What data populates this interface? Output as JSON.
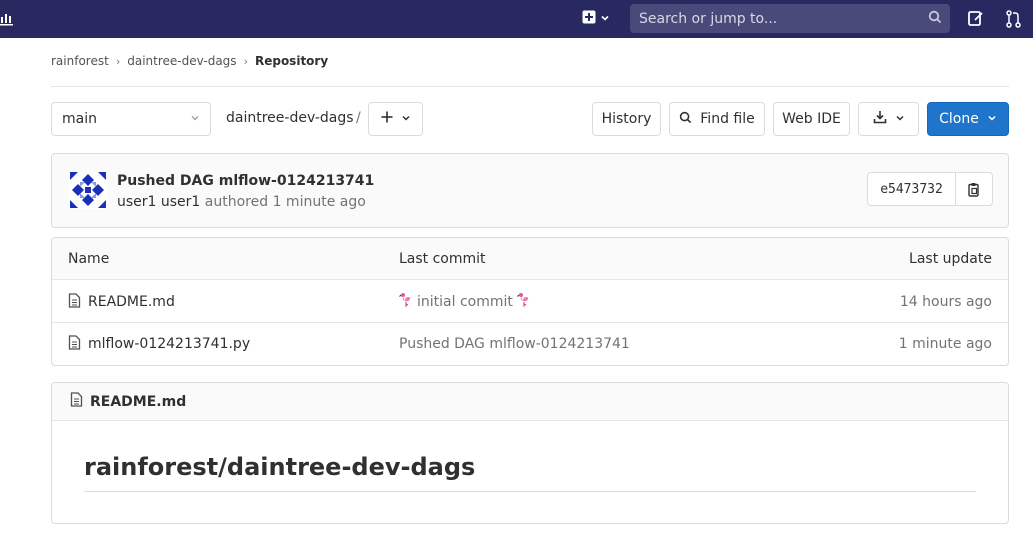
{
  "topbar": {
    "search_placeholder": "Search or jump to..."
  },
  "breadcrumb": {
    "items": [
      "rainforest",
      "daintree-dev-dags",
      "Repository"
    ]
  },
  "toolbar": {
    "branch": "main",
    "path": "daintree-dev-dags",
    "path_sep": "/",
    "history": "History",
    "find_file": "Find file",
    "web_ide": "Web IDE",
    "clone": "Clone"
  },
  "commit": {
    "title": "Pushed DAG mlflow-0124213741",
    "author": "user1 user1",
    "authored": "authored",
    "time": "1 minute ago",
    "sha": "e5473732"
  },
  "file_table": {
    "headers": {
      "name": "Name",
      "last_commit": "Last commit",
      "last_update": "Last update"
    },
    "rows": [
      {
        "name": "README.md",
        "commit": "initial commit",
        "update": "14 hours ago"
      },
      {
        "name": "mlflow-0124213741.py",
        "commit": "Pushed DAG mlflow-0124213741",
        "update": "1 minute ago"
      }
    ]
  },
  "readme": {
    "filename": "README.md",
    "heading": "rainforest/daintree-dev-dags"
  },
  "colors": {
    "navbar": "#292961",
    "clone_button": "#1f75cb",
    "flamingo": "#e8579c"
  },
  "icons": [
    "activity-icon",
    "plus-icon",
    "search-icon",
    "todo-icon",
    "merge-request-icon",
    "chevron-down-icon",
    "find-icon",
    "download-icon",
    "copy-icon",
    "file-icon",
    "flamingo-icon",
    "avatar-identicon"
  ]
}
